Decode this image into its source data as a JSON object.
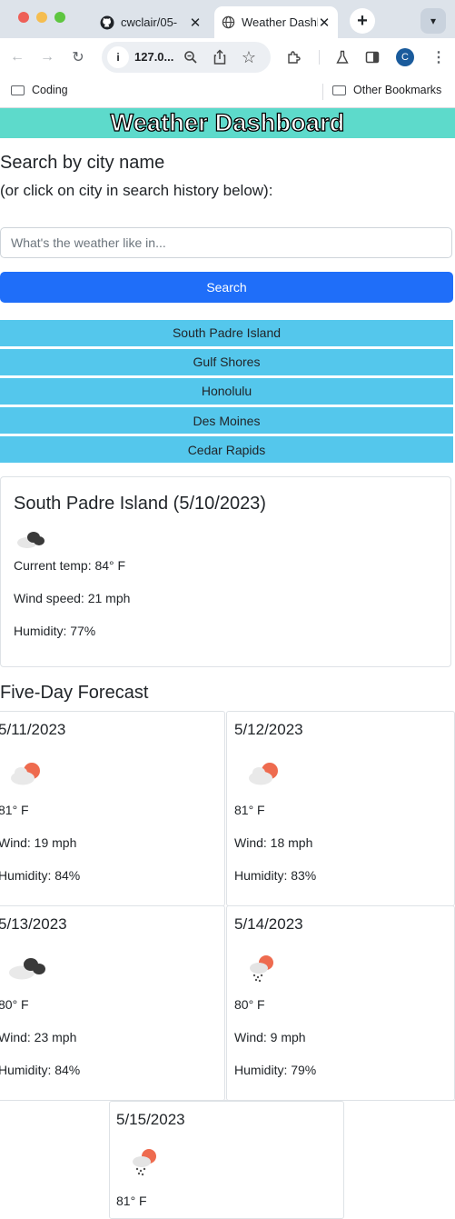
{
  "browser": {
    "tabs": [
      {
        "label": "cwclair/05-",
        "icon": "github-icon"
      },
      {
        "label": "Weather Dashboard",
        "icon": "globe-icon"
      }
    ],
    "url": "127.0...",
    "profile_initial": "C",
    "bookmarks": [
      {
        "label": "Coding"
      },
      {
        "label": "Other Bookmarks"
      }
    ]
  },
  "page": {
    "title": "Weather Dashboard",
    "header_color": "#5ddacb",
    "search": {
      "heading": "Search by city name",
      "subheading": "(or click on city in search history below):",
      "placeholder": "What's the weather like in...",
      "button_label": "Search"
    },
    "history": [
      "South Padre Island",
      "Gulf Shores",
      "Honolulu",
      "Des Moines",
      "Cedar Rapids"
    ],
    "current": {
      "heading": "South Padre Island (5/10/2023)",
      "icon": "cloudy-night-icon",
      "temp": "Current temp: 84° F",
      "wind": "Wind speed: 21 mph",
      "humidity": "Humidity: 77%"
    },
    "forecast_title": "Five-Day Forecast",
    "forecast": [
      {
        "date": "5/11/2023",
        "icon": "partly-cloudy-icon",
        "temp": "81° F",
        "wind": "Wind: 19 mph",
        "humidity": "Humidity: 84%"
      },
      {
        "date": "5/12/2023",
        "icon": "partly-cloudy-icon",
        "temp": "81° F",
        "wind": "Wind: 18 mph",
        "humidity": "Humidity: 83%"
      },
      {
        "date": "5/13/2023",
        "icon": "cloudy-icon",
        "temp": "80° F",
        "wind": "Wind: 23 mph",
        "humidity": "Humidity: 84%"
      },
      {
        "date": "5/14/2023",
        "icon": "rain-sun-icon",
        "temp": "80° F",
        "wind": "Wind: 9 mph",
        "humidity": "Humidity: 79%"
      },
      {
        "date": "5/15/2023",
        "icon": "rain-sun-icon",
        "temp": "81° F"
      }
    ]
  }
}
